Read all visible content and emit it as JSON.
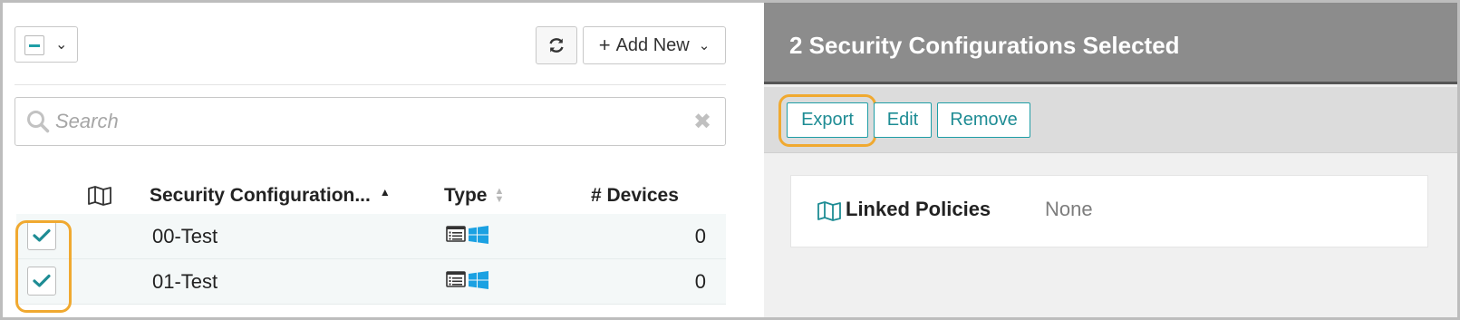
{
  "toolbar": {
    "select_icon": "minus-checkbox-icon",
    "refresh_icon": "refresh-icon",
    "add_new_label": "Add New"
  },
  "search": {
    "placeholder": "Search",
    "value": ""
  },
  "table": {
    "headers": {
      "map": "map-icon",
      "name": "Security Configuration...",
      "type": "Type",
      "devices": "# Devices"
    },
    "rows": [
      {
        "checked": true,
        "name": "00-Test",
        "type_icons": [
          "list-icon",
          "windows-icon"
        ],
        "devices": "0"
      },
      {
        "checked": true,
        "name": "01-Test",
        "type_icons": [
          "list-icon",
          "windows-icon"
        ],
        "devices": "0"
      }
    ]
  },
  "detail": {
    "title": "2 Security Configurations Selected",
    "actions": {
      "export": "Export",
      "edit": "Edit",
      "remove": "Remove"
    },
    "linked_policies": {
      "label": "Linked Policies",
      "value": "None"
    }
  },
  "colors": {
    "accent": "#1e9ea6",
    "highlight": "#f0a930",
    "header_bg": "#8c8c8c",
    "windows_blue": "#1ba1e2"
  }
}
